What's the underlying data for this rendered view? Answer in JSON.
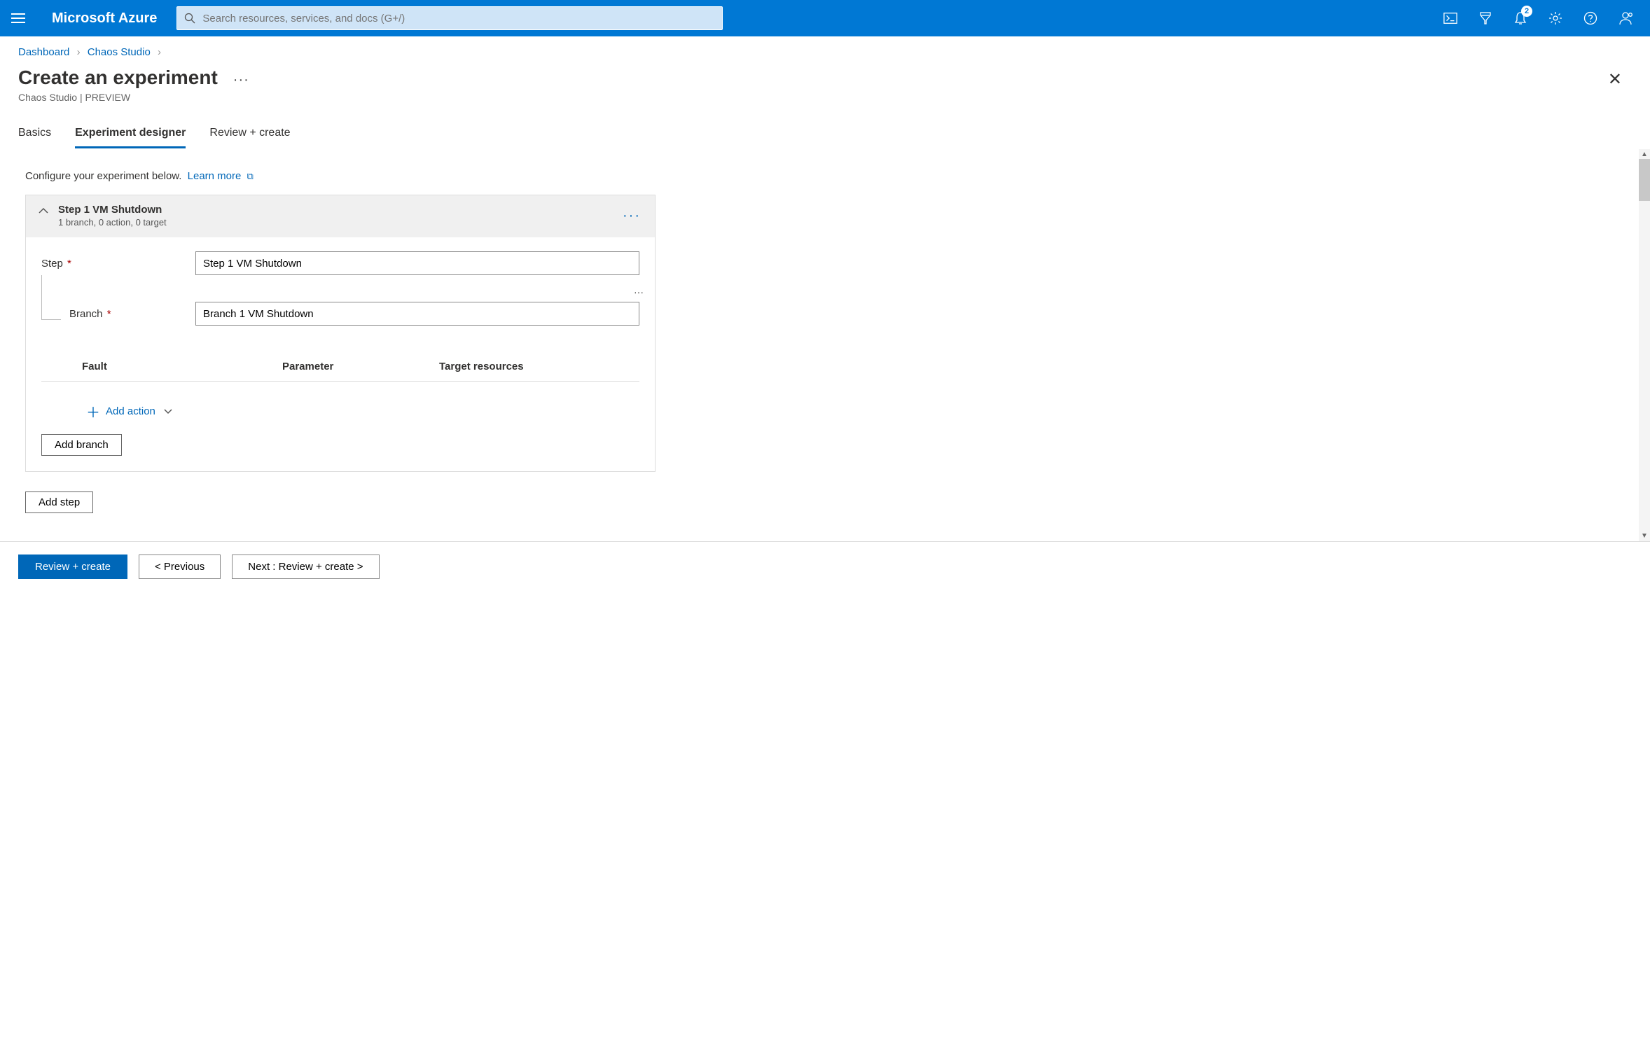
{
  "topbar": {
    "brand": "Microsoft Azure",
    "search_placeholder": "Search resources, services, and docs (G+/)",
    "notif_badge": "2"
  },
  "breadcrumb": {
    "items": [
      "Dashboard",
      "Chaos Studio"
    ]
  },
  "page": {
    "title": "Create an experiment",
    "subtitle": "Chaos Studio | PREVIEW"
  },
  "tabs": {
    "items": [
      {
        "label": "Basics"
      },
      {
        "label": "Experiment designer"
      },
      {
        "label": "Review + create"
      }
    ],
    "active_index": 1
  },
  "lead": {
    "text": "Configure your experiment below.",
    "link": "Learn more"
  },
  "step": {
    "title": "Step 1 VM Shutdown",
    "summary": "1 branch, 0 action, 0 target",
    "step_label": "Step",
    "step_value": "Step 1 VM Shutdown",
    "branch_label": "Branch",
    "branch_value": "Branch 1 VM Shutdown",
    "columns": [
      "Fault",
      "Parameter",
      "Target resources"
    ],
    "add_action": "Add action",
    "add_branch": "Add branch"
  },
  "add_step": "Add step",
  "footer": {
    "primary": "Review + create",
    "prev": "<  Previous",
    "next": "Next : Review + create  >"
  }
}
